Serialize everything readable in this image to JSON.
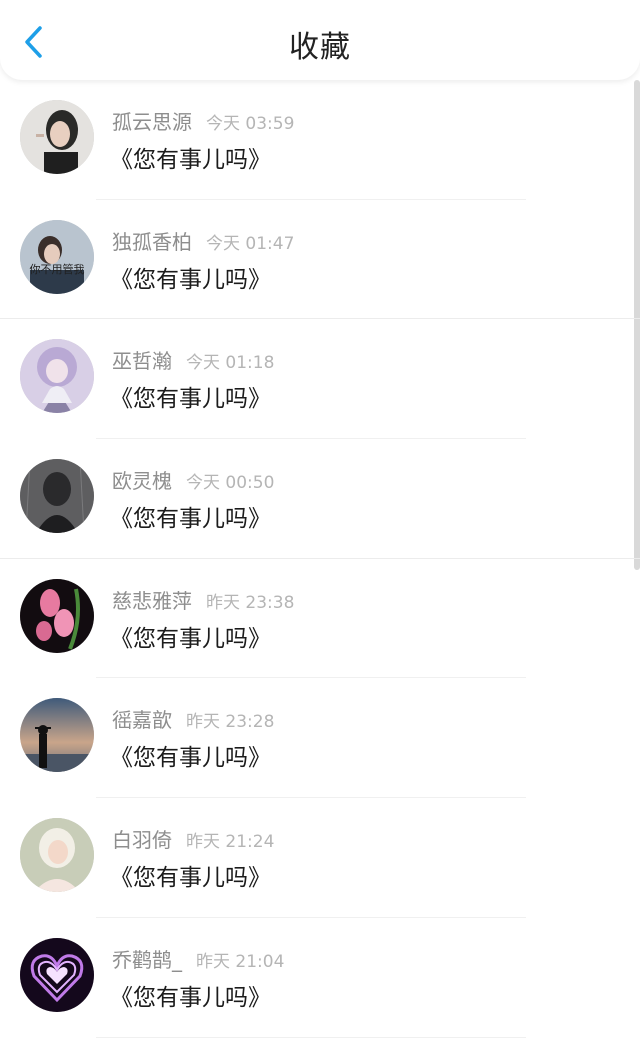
{
  "header": {
    "title": "收藏"
  },
  "items": [
    {
      "name": "孤云思源",
      "time": "今天 03:59",
      "message": "《您有事儿吗》"
    },
    {
      "name": "独孤香柏",
      "time": "今天 01:47",
      "message": "《您有事儿吗》",
      "avatar_text": "你不用管我"
    },
    {
      "name": "巫哲瀚",
      "time": "今天 01:18",
      "message": "《您有事儿吗》"
    },
    {
      "name": "欧灵槐",
      "time": "今天 00:50",
      "message": "《您有事儿吗》"
    },
    {
      "name": "慈悲雅萍",
      "time": "昨天 23:38",
      "message": "《您有事儿吗》"
    },
    {
      "name": "徭嘉歆",
      "time": "昨天 23:28",
      "message": "《您有事儿吗》"
    },
    {
      "name": "白羽倚",
      "time": "昨天 21:24",
      "message": "《您有事儿吗》"
    },
    {
      "name": "乔鹳鹊_",
      "time": "昨天 21:04",
      "message": "《您有事儿吗》"
    }
  ],
  "colors": {
    "accent": "#1e9fe8",
    "name_text": "#8e8e8e",
    "time_text": "#b5b5b5"
  }
}
